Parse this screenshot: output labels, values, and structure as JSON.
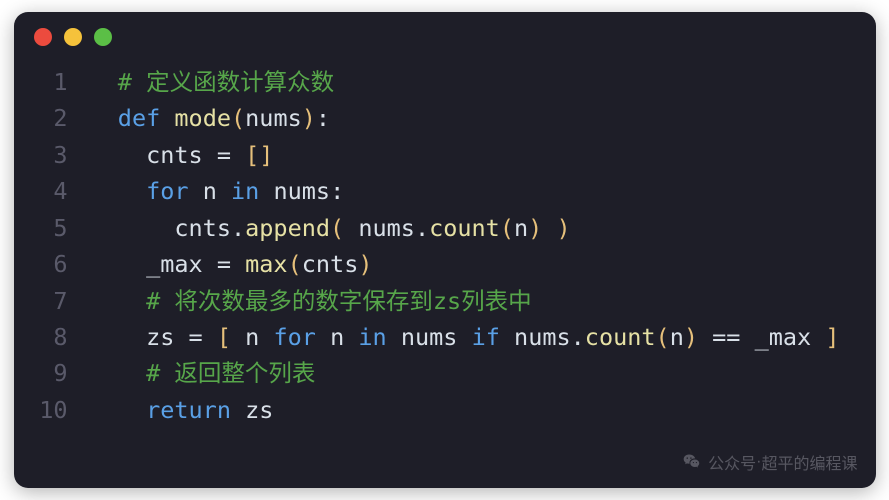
{
  "window": {
    "traffic": [
      "red",
      "yellow",
      "green"
    ]
  },
  "code": {
    "lines": [
      {
        "no": "1",
        "indent": "  ",
        "tokens": [
          [
            "cm",
            "# 定义函数计算众数"
          ]
        ]
      },
      {
        "no": "2",
        "indent": "  ",
        "tokens": [
          [
            "kw",
            "def"
          ],
          [
            "op",
            " "
          ],
          [
            "fn",
            "mode"
          ],
          [
            "pn",
            "("
          ],
          [
            "id",
            "nums"
          ],
          [
            "pn",
            ")"
          ],
          [
            "op",
            ":"
          ]
        ]
      },
      {
        "no": "3",
        "indent": "    ",
        "tokens": [
          [
            "id",
            "cnts"
          ],
          [
            "op",
            " = "
          ],
          [
            "pn",
            "[]"
          ]
        ]
      },
      {
        "no": "4",
        "indent": "    ",
        "tokens": [
          [
            "kw",
            "for"
          ],
          [
            "op",
            " "
          ],
          [
            "id",
            "n"
          ],
          [
            "op",
            " "
          ],
          [
            "kw",
            "in"
          ],
          [
            "op",
            " "
          ],
          [
            "id",
            "nums"
          ],
          [
            "op",
            ":"
          ]
        ]
      },
      {
        "no": "5",
        "indent": "      ",
        "tokens": [
          [
            "id",
            "cnts"
          ],
          [
            "op",
            "."
          ],
          [
            "call",
            "append"
          ],
          [
            "pn",
            "("
          ],
          [
            "op",
            " "
          ],
          [
            "id",
            "nums"
          ],
          [
            "op",
            "."
          ],
          [
            "call",
            "count"
          ],
          [
            "pn",
            "("
          ],
          [
            "id",
            "n"
          ],
          [
            "pn",
            ")"
          ],
          [
            "op",
            " "
          ],
          [
            "pn",
            ")"
          ]
        ]
      },
      {
        "no": "6",
        "indent": "    ",
        "tokens": [
          [
            "id",
            "_max"
          ],
          [
            "op",
            " = "
          ],
          [
            "call",
            "max"
          ],
          [
            "pn",
            "("
          ],
          [
            "id",
            "cnts"
          ],
          [
            "pn",
            ")"
          ]
        ]
      },
      {
        "no": "7",
        "indent": "    ",
        "tokens": [
          [
            "cm",
            "# 将次数最多的数字保存到zs列表中"
          ]
        ]
      },
      {
        "no": "8",
        "indent": "    ",
        "tokens": [
          [
            "id",
            "zs"
          ],
          [
            "op",
            " = "
          ],
          [
            "pn",
            "["
          ],
          [
            "op",
            " "
          ],
          [
            "id",
            "n"
          ],
          [
            "op",
            " "
          ],
          [
            "kw",
            "for"
          ],
          [
            "op",
            " "
          ],
          [
            "id",
            "n"
          ],
          [
            "op",
            " "
          ],
          [
            "kw",
            "in"
          ],
          [
            "op",
            " "
          ],
          [
            "id",
            "nums"
          ],
          [
            "op",
            " "
          ],
          [
            "kw",
            "if"
          ],
          [
            "op",
            " "
          ],
          [
            "id",
            "nums"
          ],
          [
            "op",
            "."
          ],
          [
            "call",
            "count"
          ],
          [
            "pn",
            "("
          ],
          [
            "id",
            "n"
          ],
          [
            "pn",
            ")"
          ],
          [
            "op",
            " == "
          ],
          [
            "id",
            "_max"
          ],
          [
            "op",
            " "
          ],
          [
            "pn",
            "]"
          ]
        ]
      },
      {
        "no": "9",
        "indent": "    ",
        "tokens": [
          [
            "cm",
            "# 返回整个列表"
          ]
        ]
      },
      {
        "no": "10",
        "indent": "    ",
        "tokens": [
          [
            "kw",
            "return"
          ],
          [
            "op",
            " "
          ],
          [
            "id",
            "zs"
          ]
        ]
      }
    ]
  },
  "watermark": {
    "label": "公众号",
    "separator": " · ",
    "name": "超平的编程课"
  }
}
